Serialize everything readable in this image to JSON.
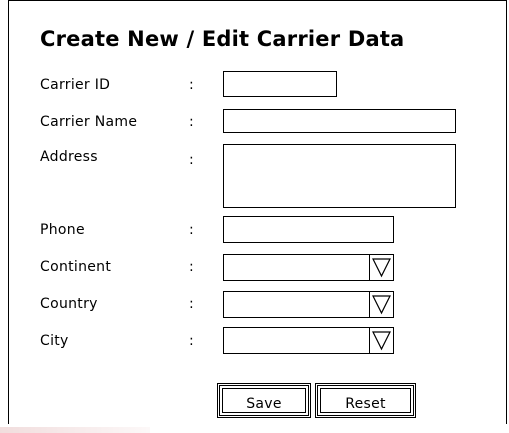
{
  "form": {
    "title": "Create New / Edit Carrier Data",
    "separator": ":",
    "fields": {
      "carrier_id": {
        "label": "Carrier ID",
        "value": ""
      },
      "carrier_name": {
        "label": "Carrier Name",
        "value": ""
      },
      "address": {
        "label": "Address",
        "value": ""
      },
      "phone": {
        "label": "Phone",
        "value": ""
      },
      "continent": {
        "label": "Continent",
        "selected": ""
      },
      "country": {
        "label": "Country",
        "selected": ""
      },
      "city": {
        "label": "City",
        "selected": ""
      }
    },
    "buttons": {
      "save": "Save",
      "reset": "Reset"
    }
  },
  "icons": {
    "dropdown": "triangle-down-icon"
  }
}
